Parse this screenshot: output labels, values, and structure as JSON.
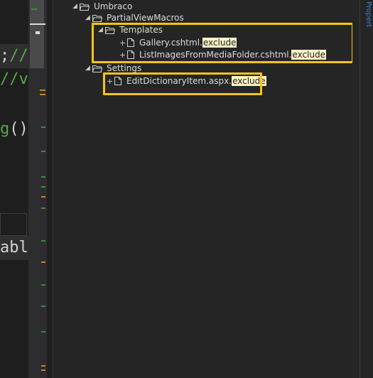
{
  "editor": {
    "line1": "//",
    "line1_semi": ";",
    "line2": "//v",
    "line3": "g",
    "line3_paren": "()",
    "line4": "abl"
  },
  "tree": {
    "root": "Umbraco",
    "partial": "PartialViewMacros",
    "templates": "Templates",
    "gallery_name": "Gallery.cshtml.",
    "gallery_ext": "exclude",
    "listimages_name": "ListImagesFromMediaFolder.cshtml.",
    "listimages_ext": "exclude",
    "settings": "Settings",
    "editdict_name": "EditDictionaryItem.aspx.",
    "editdict_ext": "exclude"
  },
  "right_tab": {
    "label": "Propert"
  },
  "colors": {
    "highlight_box": "#f5c518",
    "exclude_bg": "#fbf3c5",
    "comment_green": "#57a64a"
  }
}
